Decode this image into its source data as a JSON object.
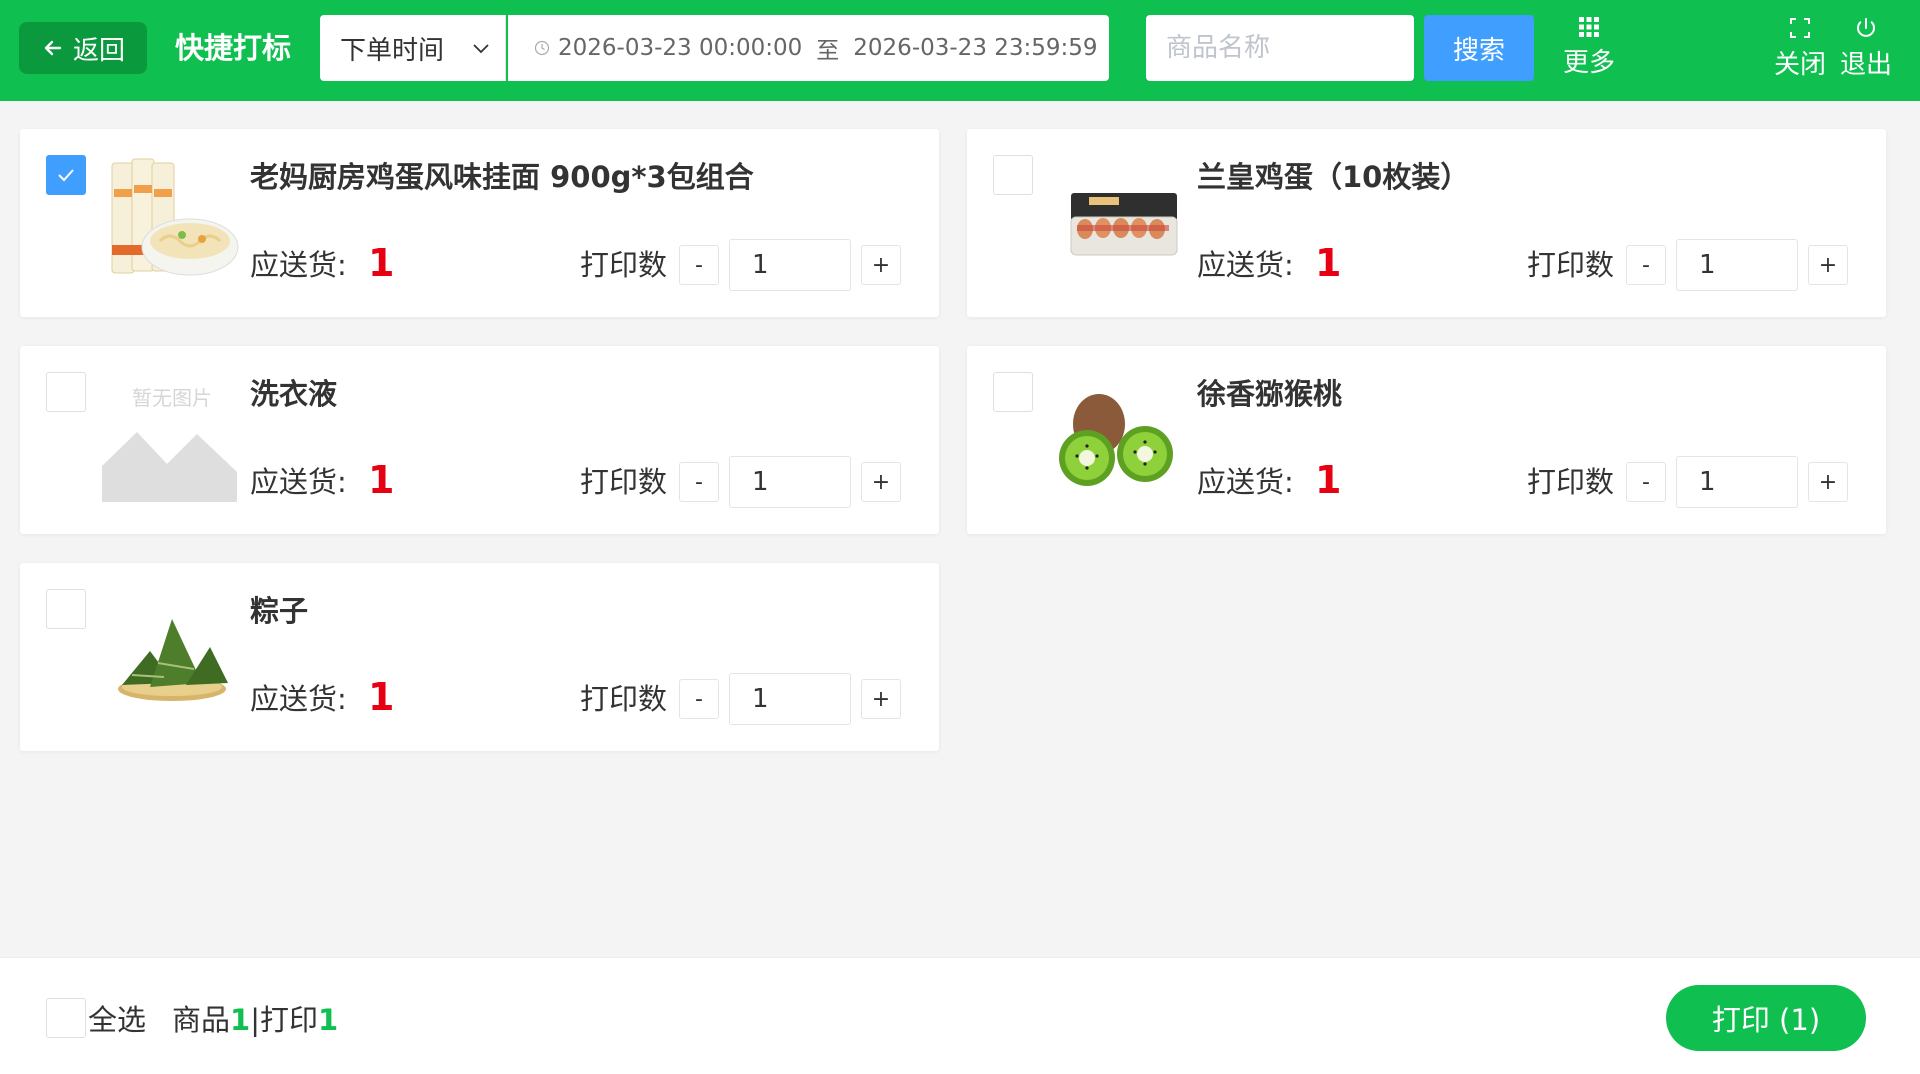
{
  "header": {
    "back_label": "返回",
    "title": "快捷打标",
    "time_filter": "下单时间",
    "date_start": "2026-03-23 00:00:00",
    "date_sep": "至",
    "date_end": "2026-03-23 23:59:59",
    "search_placeholder": "商品名称",
    "search_label": "搜索",
    "more_label": "更多",
    "close_label": "关闭",
    "logout_label": "退出"
  },
  "card_labels": {
    "ship": "应送货:",
    "print": "打印数",
    "minus": "-",
    "plus": "+"
  },
  "products": [
    {
      "name": "老妈厨房鸡蛋风味挂面 900g*3包组合",
      "ship_qty": "1",
      "print_qty": "1",
      "checked": true,
      "image": "noodles-package-image"
    },
    {
      "name": "兰皇鸡蛋（10枚装）",
      "ship_qty": "1",
      "print_qty": "1",
      "checked": false,
      "image": "egg-carton-image"
    },
    {
      "name": "洗衣液",
      "ship_qty": "1",
      "print_qty": "1",
      "checked": false,
      "image": "no-image-placeholder",
      "no_image_text": "暂无图片"
    },
    {
      "name": "徐香猕猴桃",
      "ship_qty": "1",
      "print_qty": "1",
      "checked": false,
      "image": "kiwi-fruit-image"
    },
    {
      "name": "粽子",
      "ship_qty": "1",
      "print_qty": "1",
      "checked": false,
      "image": "zongzi-image"
    }
  ],
  "footer": {
    "select_all_label": "全选",
    "goods_label": "商品",
    "goods_count": "1",
    "print_label": "打印",
    "print_count": "1",
    "print_button": "打印 (1)"
  },
  "colors": {
    "brand_green": "#0fbf4f",
    "search_blue": "#409eff",
    "qty_red": "#e60012"
  }
}
